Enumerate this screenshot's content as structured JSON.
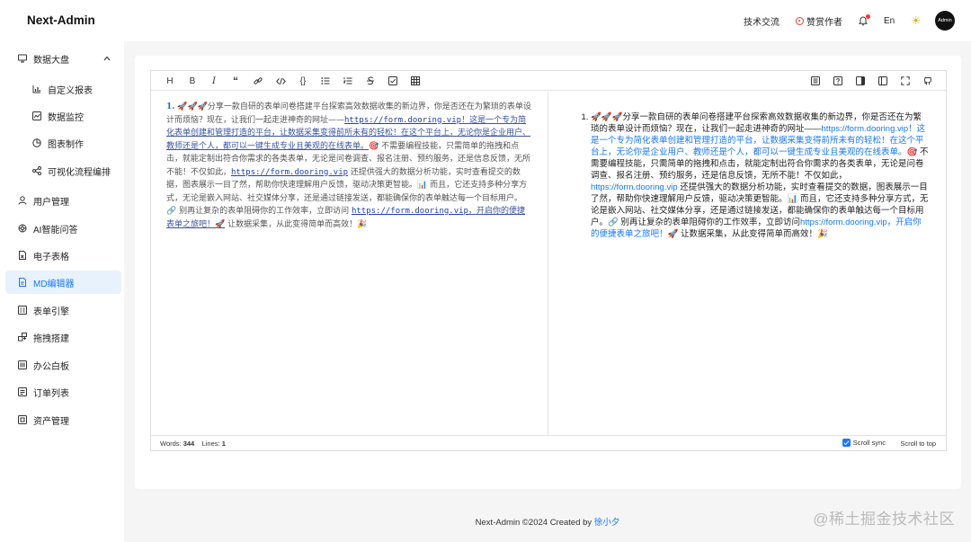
{
  "app": {
    "brand": "Next-Admin"
  },
  "header": {
    "tech_label": "技术交流",
    "sponsor_label": "赞赏作者",
    "lang_label": "En",
    "avatar_label": "Admin"
  },
  "sidebar": {
    "items": [
      {
        "label": "数据大盘",
        "icon": "monitor-icon",
        "expanded": true
      },
      {
        "label": "自定义报表",
        "icon": "bar-chart-icon",
        "sub": true
      },
      {
        "label": "数据监控",
        "icon": "line-chart-icon",
        "sub": true
      },
      {
        "label": "图表制作",
        "icon": "pie-chart-icon",
        "sub": true
      },
      {
        "label": "可视化流程编排",
        "icon": "flow-icon",
        "sub": true
      },
      {
        "label": "用户管理",
        "icon": "user-icon"
      },
      {
        "label": "AI智能问答",
        "icon": "ai-icon"
      },
      {
        "label": "电子表格",
        "icon": "sheet-icon"
      },
      {
        "label": "MD编辑器",
        "icon": "markdown-icon",
        "active": true
      },
      {
        "label": "表单引擎",
        "icon": "form-icon"
      },
      {
        "label": "拖拽搭建",
        "icon": "drag-icon"
      },
      {
        "label": "办公白板",
        "icon": "whiteboard-icon"
      },
      {
        "label": "订单列表",
        "icon": "order-icon"
      },
      {
        "label": "资产管理",
        "icon": "asset-icon"
      }
    ]
  },
  "editor": {
    "source": {
      "num": "1.",
      "seg1": " 🚀🚀🚀分享一款自研的表单问卷搭建平台探索高效数据收集的新边界，你是否还在为繁琐的表单设计而烦恼？现在，让我们一起走进神奇的网址——",
      "url1": "https://form.dooring.vip",
      "seg2": "！这是一个专为简化表单创建和管理打造的平台，让数据采集变得前所未有的轻松！在这个平台上，无论你是企业用户、教师还是个人，都可以一键生成专业且美观的在线表单。",
      "seg3": "🎯 不需要编程技能，只需简单的拖拽和点击，就能定制出符合你需求的各类表单，无论是问卷调查、报名注册、预约服务，还是信息反馈，无所不能！不仅如此，",
      "url2": "https://form.dooring.vip",
      "seg4": " 还提供强大的数据分析功能，实时查看提交的数据，图表展示一目了然，帮助你快速理解用户反馈，驱动决策更智能。📊 而且，它还支持多种分享方式，无论是嵌入网站、社交媒体分享，还是通过链接发送，都能确保你的表单触达每一个目标用户。🔗 别再让复杂的表单阻碍你的工作效率，立即访问 ",
      "url3": "https://form.dooring.vip",
      "seg5": "，开启你的便捷表单之旅吧！🚀",
      "seg6": " 让数据采集，从此变得简单而高效！🎉"
    },
    "preview": {
      "seg1": "🚀🚀🚀分享一款自研的表单问卷搭建平台探索高效数据收集的新边界，你是否还在为繁琐的表单设计而烦恼？现在，让我们一起走进神奇的网址——",
      "link1": "https://form.dooring.vip！这是一个专为简化表单创建和管理打造的平台，让数据采集变得前所未有的轻松！在这个平台上，无论你是企业用户、教师还是个人，都可以一键生成专业且美观的在线表单。",
      "seg2": "🎯 不需要编程技能，只需简单的拖拽和点击，就能定制出符合你需求的各类表单，无论是问卷调查、报名注册、预约服务，还是信息反馈，无所不能！不仅如此，",
      "link2": "https://form.dooring.vip",
      "seg3": " 还提供强大的数据分析功能，实时查看提交的数据，图表展示一目了然，帮助你快速理解用户反馈，驱动决策更智能。📊 而且，它还支持多种分享方式，无论是嵌入网站、社交媒体分享，还是通过链接发送，都能确保你的表单触达每一个目标用户。🔗 别再让复杂的表单阻碍你的工作效率，立即访问",
      "link3": "https://form.dooring.vip，开启你的便捷表单之旅吧！",
      "seg4": "🚀 让数据采集，从此变得简单而高效！🎉"
    },
    "status": {
      "words_label": "Words:",
      "words_value": "344",
      "lines_label": "Lines:",
      "lines_value": "1",
      "scroll_sync": "Scroll sync",
      "scroll_top": "Scroll to top"
    }
  },
  "footer": {
    "text": "Next-Admin ©2024 Created by ",
    "author": "徐小夕"
  },
  "watermark": "@稀土掘金技术社区"
}
